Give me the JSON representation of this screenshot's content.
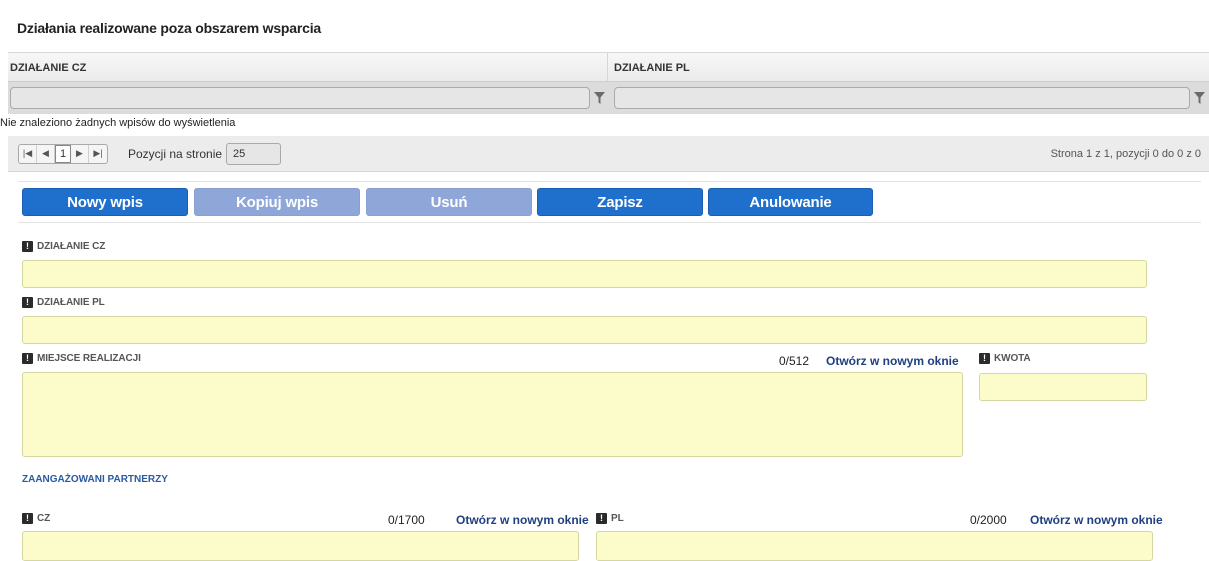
{
  "section_title": "Działania realizowane poza obszarem wsparcia",
  "grid": {
    "columns": [
      "DZIAŁANIE CZ",
      "DZIAŁANIE PL"
    ],
    "empty_message": "Nie znaleziono żadnych wpisów do wyświetlenia"
  },
  "pager": {
    "first": "|◀",
    "prev": "◀",
    "page": "1",
    "next": "▶",
    "last": "▶|",
    "per_page_label": "Pozycji na stronie",
    "per_page_value": "25",
    "info": "Strona 1 z 1, pozycji 0 do 0 z 0"
  },
  "buttons": {
    "new": "Nowy wpis",
    "copy": "Kopiuj wpis",
    "delete": "Usuń",
    "save": "Zapisz",
    "cancel": "Anulowanie"
  },
  "form": {
    "req_mark": "!",
    "dzialanie_cz_label": "DZIAŁANIE CZ",
    "dzialanie_pl_label": "DZIAŁANIE PL",
    "miejsce_label": "MIEJSCE REALIZACJI",
    "miejsce_counter": "0/512",
    "open_new_window": "Otwórz w nowym oknie",
    "kwota_label": "KWOTA",
    "partners_heading": "ZAANGAŻOWANI PARTNERZY",
    "cz_label": "CZ",
    "cz_counter": "0/1700",
    "pl_label": "PL",
    "pl_counter": "0/2000"
  },
  "colors": {
    "primary_button": "#1f6fcc",
    "disabled_button": "#8fa6d9",
    "required_field": "#fcfccb",
    "link": "#1f3f80"
  }
}
